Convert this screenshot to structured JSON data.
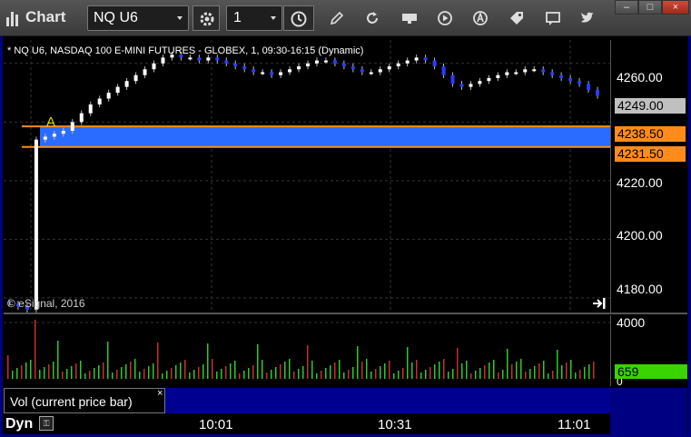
{
  "window": {
    "title": "Chart",
    "minimize": "–",
    "maximize": "□",
    "close": "×"
  },
  "toolbar": {
    "symbol": "NQ U6",
    "interval": "1",
    "icons": [
      "settings-icon",
      "clock-icon",
      "pencil-icon",
      "refresh-icon",
      "get-icon",
      "play-icon",
      "alert-icon",
      "tag-icon",
      "comment-icon",
      "twitter-icon"
    ]
  },
  "chart": {
    "header": "* NQ U6, NASDAQ 100 E-MINI FUTURES - GLOBEX, 1, 09:30-16:15 (Dynamic)",
    "copyright": "© eSignal, 2016",
    "annotation": "A",
    "price_ticks": [
      "4260.00",
      "4220.00",
      "4200.00",
      "4180.00"
    ],
    "last_price": "4249.00",
    "upper_line": "4238.50",
    "lower_line": "4231.50",
    "volume_tick_top": "4000",
    "volume_tick_zero": "0",
    "volume_last": "659",
    "study_label": "Vol (current price bar)",
    "study_close": "×",
    "time_labels": [
      "10:01",
      "10:31",
      "11:01"
    ],
    "mode_label": "Dyn",
    "colors": {
      "band": "#2a6cff",
      "band_border": "#ff8c1a",
      "up": "#ffffff",
      "down": "#2a3cff",
      "vol_up": "#2ec82e",
      "vol_down": "#c82e2e",
      "frame": "#000082"
    }
  },
  "chart_data": {
    "type": "bar",
    "subtype": "candlestick-with-volume",
    "ylim": [
      4175,
      4268
    ],
    "band": [
      4231.5,
      4238.5
    ],
    "close_series_approx": [
      4178,
      4177,
      4176,
      4234,
      4235,
      4236,
      4237,
      4240,
      4243,
      4246,
      4248,
      4250,
      4252,
      4254,
      4256,
      4258,
      4260,
      4262,
      4263,
      4262,
      4262,
      4261,
      4262,
      4261,
      4260,
      4259,
      4258,
      4257,
      4257,
      4256,
      4257,
      4258,
      4259,
      4260,
      4261,
      4261,
      4260,
      4259,
      4258,
      4257,
      4257,
      4258,
      4259,
      4260,
      4261,
      4262,
      4261,
      4259,
      4256,
      4253,
      4252,
      4253,
      4254,
      4255,
      4256,
      4257,
      4257,
      4258,
      4258,
      4257,
      4256,
      4255,
      4254,
      4253,
      4251,
      4249
    ],
    "volume_max_tick": 4000
  }
}
